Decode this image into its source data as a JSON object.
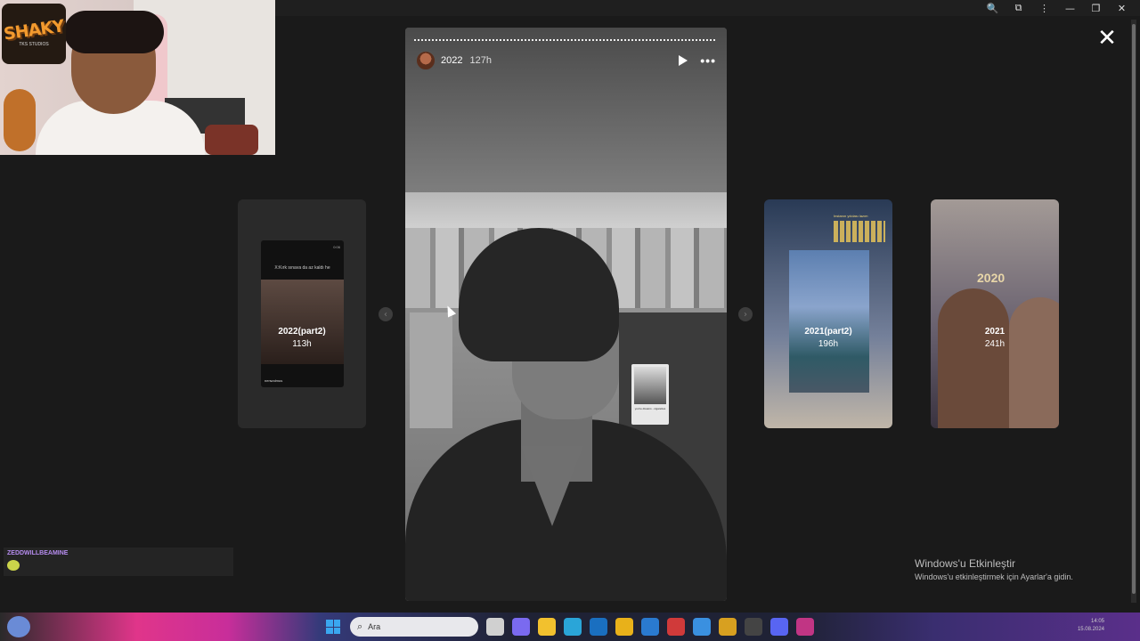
{
  "window": {
    "icons": [
      "zoom-icon",
      "extensions-icon",
      "menu-icon",
      "minimize-icon",
      "restore-icon",
      "close-icon"
    ]
  },
  "overlay": {
    "logo_text": "SHAKY",
    "logo_sub": "TKS STUDIOS"
  },
  "story": {
    "title": "2022",
    "time_ago": "127h",
    "sticker_caption": "you're dreams - cigarettes"
  },
  "thumbnails": [
    {
      "label": "2022(part2)",
      "hours": "113h",
      "caption": "X:Kırk sınava da az kaldı he",
      "footer": "nenwolmus",
      "time": "0:06"
    },
    {
      "label": "2021(part2)",
      "hours": "196h",
      "caption": "Instanın yıkılası lazım"
    },
    {
      "label": "2021",
      "hours": "241h",
      "overlay_number": "2020"
    }
  ],
  "viewer": {
    "close_label": "✕",
    "prev_label": "‹",
    "next_label": "›"
  },
  "chat": {
    "username": "ZEDDWILLBEAMINE"
  },
  "watermark": {
    "title": "Windows'u Etkinleştir",
    "subtitle": "Windows'u etkinleştirmek için Ayarlar'a gidin."
  },
  "taskbar": {
    "search_placeholder": "Ara",
    "clock_time": "14:05",
    "clock_date": "15.08.2024"
  },
  "colors": {
    "chat_user": "#b78df0",
    "start": "#3aa7f0"
  }
}
